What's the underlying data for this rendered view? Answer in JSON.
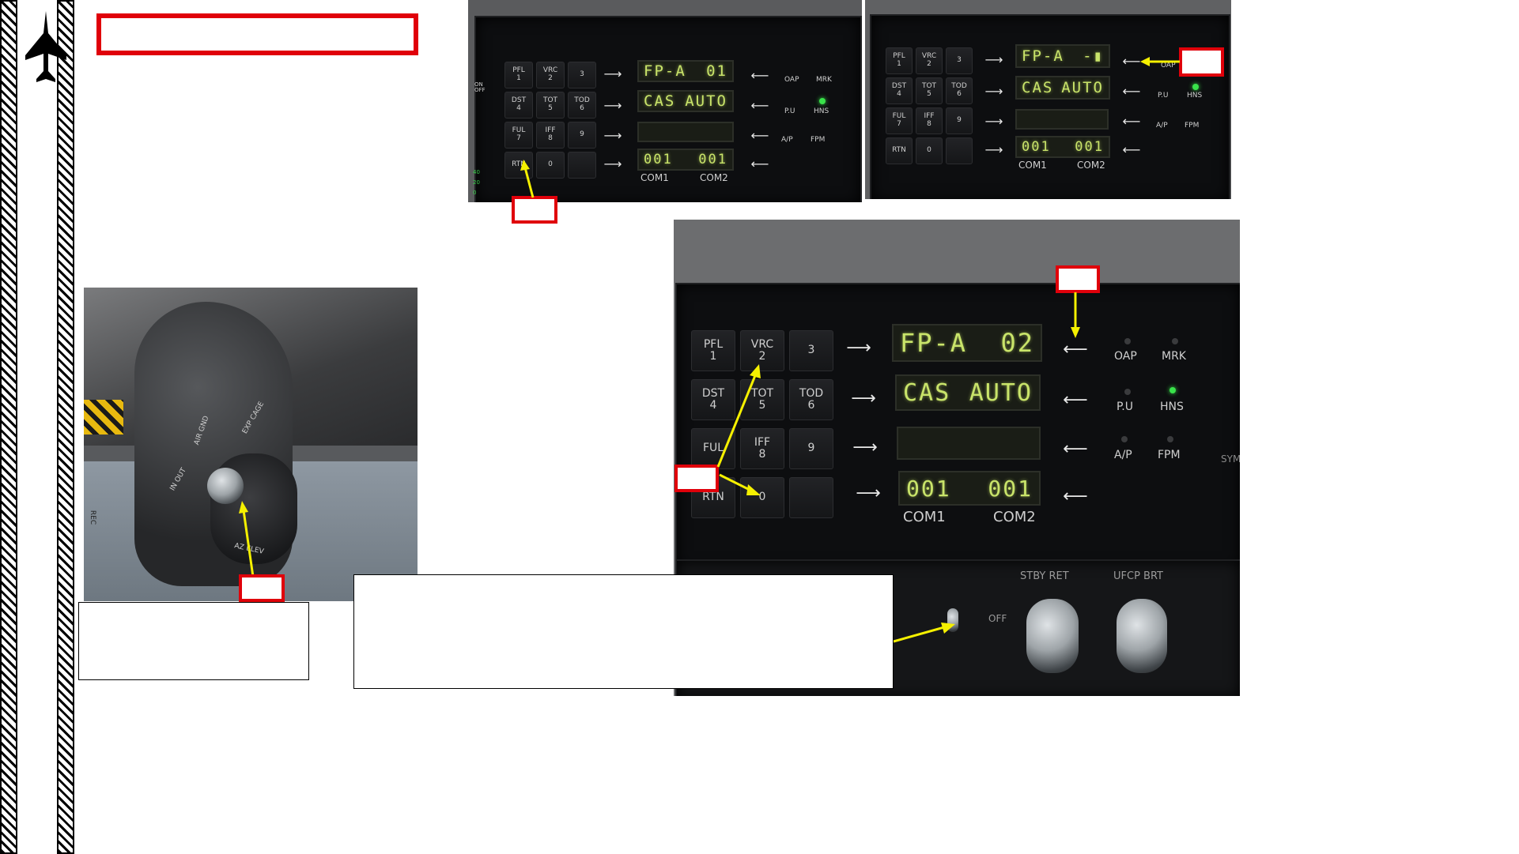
{
  "ufcp_top_left": {
    "keys": [
      {
        "l1": "PFL",
        "l2": "1"
      },
      {
        "l1": "VRC",
        "l2": "2"
      },
      {
        "l1": "",
        "l2": "3"
      },
      {
        "l1": "DST",
        "l2": "4"
      },
      {
        "l1": "TOT",
        "l2": "5"
      },
      {
        "l1": "TOD",
        "l2": "6"
      },
      {
        "l1": "FUL",
        "l2": "7"
      },
      {
        "l1": "IFF",
        "l2": "8"
      },
      {
        "l1": "",
        "l2": "9"
      },
      {
        "l1": "RTN",
        "l2": ""
      },
      {
        "l1": "",
        "l2": "0"
      },
      {
        "l1": "",
        "l2": ""
      }
    ],
    "line1_left": "FP-A",
    "line1_right": "01",
    "line2_left": "CAS",
    "line2_right": "AUTO",
    "line4_left": "001",
    "line4_right": "001",
    "com1": "COM1",
    "com2": "COM2",
    "right_labels": [
      "OAP",
      "MRK",
      "P.U",
      "HNS",
      "A/P",
      "FPM"
    ],
    "side_text": "ON OFF",
    "scale_text": [
      "40",
      "20",
      "0"
    ]
  },
  "ufcp_top_right": {
    "line1_left": "FP-A",
    "line1_right": "-▮",
    "line2_left": "CAS",
    "line2_right": "AUTO",
    "line4_left": "001",
    "line4_right": "001",
    "com1": "COM1",
    "com2": "COM2",
    "right_labels": [
      "OAP",
      "P.U",
      "HNS",
      "A/P",
      "FPM"
    ]
  },
  "ufcp_large": {
    "keys": [
      {
        "l1": "PFL",
        "l2": "1"
      },
      {
        "l1": "VRC",
        "l2": "2"
      },
      {
        "l1": "",
        "l2": "3"
      },
      {
        "l1": "DST",
        "l2": "4"
      },
      {
        "l1": "TOT",
        "l2": "5"
      },
      {
        "l1": "TOD",
        "l2": "6"
      },
      {
        "l1": "FUL",
        "l2": ""
      },
      {
        "l1": "IFF",
        "l2": "8"
      },
      {
        "l1": "",
        "l2": "9"
      },
      {
        "l1": "RTN",
        "l2": ""
      },
      {
        "l1": "",
        "l2": "0"
      },
      {
        "l1": "",
        "l2": ""
      }
    ],
    "line1_left": "FP-A",
    "line1_right": "02",
    "line2_left": "CAS",
    "line2_right": "AUTO",
    "line4_left": "001",
    "line4_right": "001",
    "com1": "COM1",
    "com2": "COM2",
    "right_labels": [
      "OAP",
      "MRK",
      "P.U",
      "HNS",
      "A/P",
      "FPM"
    ],
    "stby_ret": "STBY RET",
    "ufcp_brt": "UFCP BRT",
    "off": "OFF",
    "sym": "SYM"
  },
  "throttle_photo": {
    "labels": [
      "AIR GND",
      "IN OUT",
      "EXP CAGE",
      "AZ ELEV",
      "REC"
    ]
  },
  "colors": {
    "callout_red": "#e0000a",
    "arrow_yellow": "#f5f000",
    "display_green": "#c9e46a",
    "led_green": "#39e24a"
  }
}
